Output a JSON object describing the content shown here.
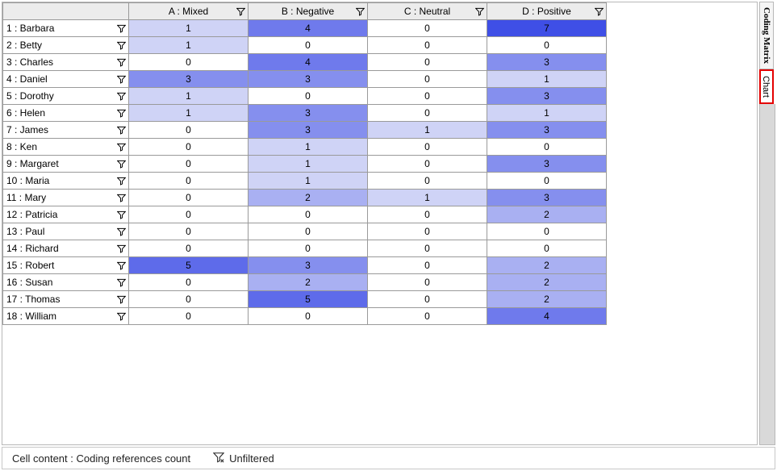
{
  "columns": [
    {
      "id": "A",
      "label": "A : Mixed"
    },
    {
      "id": "B",
      "label": "B : Negative"
    },
    {
      "id": "C",
      "label": "C : Neutral"
    },
    {
      "id": "D",
      "label": "D : Positive"
    }
  ],
  "rows": [
    {
      "label": "1 : Barbara",
      "cells": [
        1,
        4,
        0,
        7
      ]
    },
    {
      "label": "2 : Betty",
      "cells": [
        1,
        0,
        0,
        0
      ]
    },
    {
      "label": "3 : Charles",
      "cells": [
        0,
        4,
        0,
        3
      ]
    },
    {
      "label": "4 : Daniel",
      "cells": [
        3,
        3,
        0,
        1
      ]
    },
    {
      "label": "5 : Dorothy",
      "cells": [
        1,
        0,
        0,
        3
      ]
    },
    {
      "label": "6 : Helen",
      "cells": [
        1,
        3,
        0,
        1
      ]
    },
    {
      "label": "7 : James",
      "cells": [
        0,
        3,
        1,
        3
      ]
    },
    {
      "label": "8 : Ken",
      "cells": [
        0,
        1,
        0,
        0
      ]
    },
    {
      "label": "9 : Margaret",
      "cells": [
        0,
        1,
        0,
        3
      ]
    },
    {
      "label": "10 : Maria",
      "cells": [
        0,
        1,
        0,
        0
      ]
    },
    {
      "label": "11 : Mary",
      "cells": [
        0,
        2,
        1,
        3
      ]
    },
    {
      "label": "12 : Patricia",
      "cells": [
        0,
        0,
        0,
        2
      ]
    },
    {
      "label": "13 : Paul",
      "cells": [
        0,
        0,
        0,
        0
      ]
    },
    {
      "label": "14 : Richard",
      "cells": [
        0,
        0,
        0,
        0
      ]
    },
    {
      "label": "15 : Robert",
      "cells": [
        5,
        3,
        0,
        2
      ]
    },
    {
      "label": "16 : Susan",
      "cells": [
        0,
        2,
        0,
        2
      ]
    },
    {
      "label": "17 : Thomas",
      "cells": [
        0,
        5,
        0,
        2
      ]
    },
    {
      "label": "18 : William",
      "cells": [
        0,
        0,
        0,
        4
      ]
    }
  ],
  "side_tabs": {
    "coding_matrix": "Coding Matrix",
    "chart": "Chart"
  },
  "status": {
    "cell_content": "Cell content : Coding references count",
    "filter_state": "Unfiltered"
  }
}
